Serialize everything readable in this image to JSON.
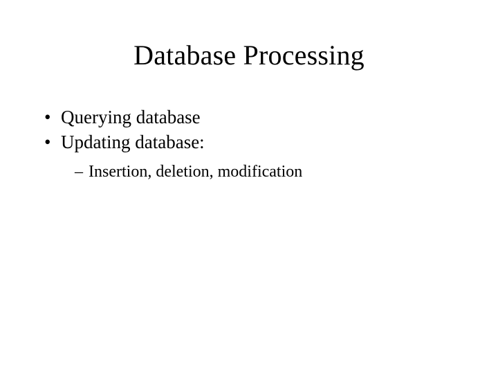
{
  "title": "Database Processing",
  "bullets": [
    {
      "text": "Querying database"
    },
    {
      "text": "Updating database:"
    }
  ],
  "subbullets": [
    {
      "text": "Insertion, deletion, modification"
    }
  ]
}
